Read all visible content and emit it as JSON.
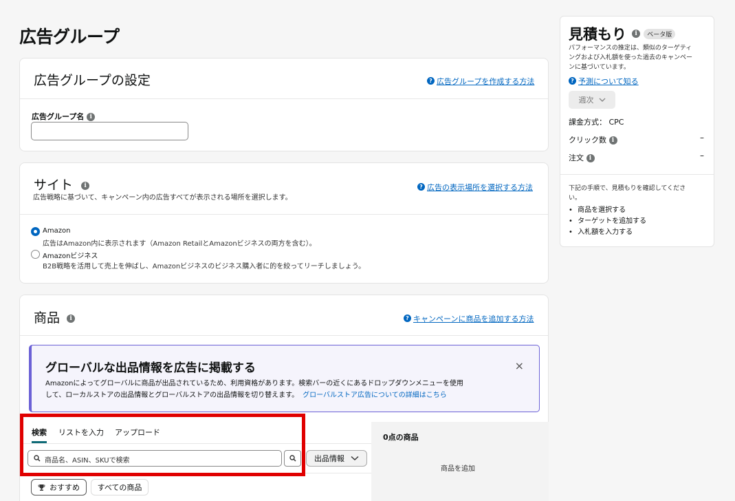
{
  "page": {
    "title": "広告グループ"
  },
  "settings": {
    "heading": "広告グループの設定",
    "help_link": "広告グループを作成する方法",
    "name_label": "広告グループ名",
    "name_value": ""
  },
  "site": {
    "heading": "サイト",
    "description": "広告戦略に基づいて、キャンペーン内の広告すべてが表示される場所を選択します。",
    "help_link": "広告の表示場所を選択する方法",
    "options": [
      {
        "label": "Amazon",
        "desc": "広告はAmazon内に表示されます（Amazon RetailとAmazonビジネスの両方を含む）。",
        "selected": true
      },
      {
        "label": "Amazonビジネス",
        "desc": "B2B戦略を活用して売上を伸ばし、Amazonビジネスのビジネス購入者に的を絞ってリーチしましょう。",
        "selected": false
      }
    ]
  },
  "products": {
    "heading": "商品",
    "help_link": "キャンペーンに商品を追加する方法",
    "banner": {
      "title": "グローバルな出品情報を広告に掲載する",
      "body_line1": "Amazonによってグローバルに商品が出品されているため、利用資格があります。検索バーの近くにあるドロップダウンメニューを使用",
      "body_line2": "して、ローカルストアの出品情報とグローバルストアの出品情報を切り替えます。",
      "link": "グローバルストア広告についての詳細はこちら",
      "close": "×"
    },
    "tabs": [
      "検索",
      "リストを入力",
      "アップロード"
    ],
    "search_placeholder": "商品名、ASIN、SKUで検索",
    "listing_dropdown": "出品情報",
    "filters": [
      "おすすめ",
      "すべての商品"
    ],
    "right_header": "0点の商品",
    "right_empty": "商品を追加"
  },
  "estimate": {
    "title": "見積もり",
    "beta": "ベータ版",
    "desc_line1": "パフォーマンスの推定は、類似のターゲティ",
    "desc_line2": "ングおよび入札額を使った過去のキャンペー",
    "desc_line3": "ンに基づいています。",
    "link": "予測について知る",
    "period": "週次",
    "billing": "課金方式： CPC",
    "clicks_label": "クリック数",
    "clicks_value": "–",
    "orders_label": "注文",
    "orders_value": "–",
    "steps_intro_line1": "下記の手順で、見積もりを確認してくださ",
    "steps_intro_line2": "い。",
    "steps": [
      "商品を選択する",
      "ターゲットを追加する",
      "入札額を入力する"
    ]
  },
  "colors": {
    "link": "#0066c0",
    "highlight": "#e00000",
    "banner_border": "#6b61d6",
    "banner_bg": "#f5f4fc"
  }
}
